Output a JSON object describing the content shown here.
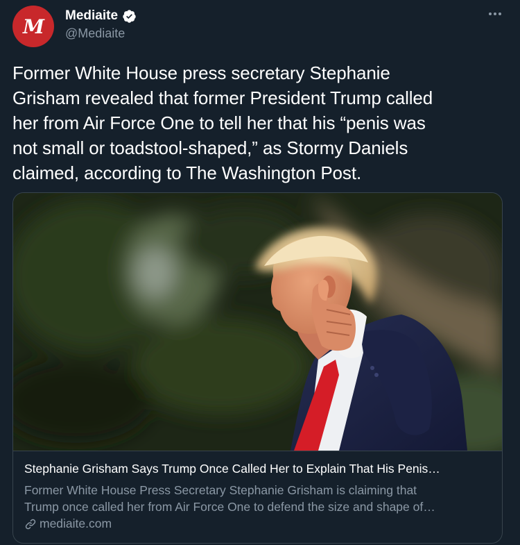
{
  "account": {
    "name": "Mediaite",
    "handle": "@Mediaite",
    "avatar_letter": "M",
    "verified": true
  },
  "tweet": {
    "lines": [
      "Former White House press secretary Stephanie",
      "Grisham revealed that former President Trump called",
      "her from Air Force One to tell her that his “penis was",
      "not small or toadstool-shaped,” as Stormy Daniels",
      "claimed, according to The Washington Post."
    ]
  },
  "card": {
    "title": "Stephanie Grisham Says Trump Once Called Her to Explain That His Penis…",
    "description_lines": [
      "Former White House Press Secretary Stephanie Grisham is claiming that",
      "Trump once called her from Air Force One to defend the size and shape of…"
    ],
    "domain": "mediaite.com"
  },
  "icons": {
    "verified": "verified-badge-icon",
    "more": "more-options-icon",
    "link": "link-icon"
  },
  "colors": {
    "background": "#15202b",
    "brand_red": "#c8282b",
    "verified_blue": "#1d9bf0",
    "secondary_text": "#8b98a5",
    "border": "#38444d"
  }
}
